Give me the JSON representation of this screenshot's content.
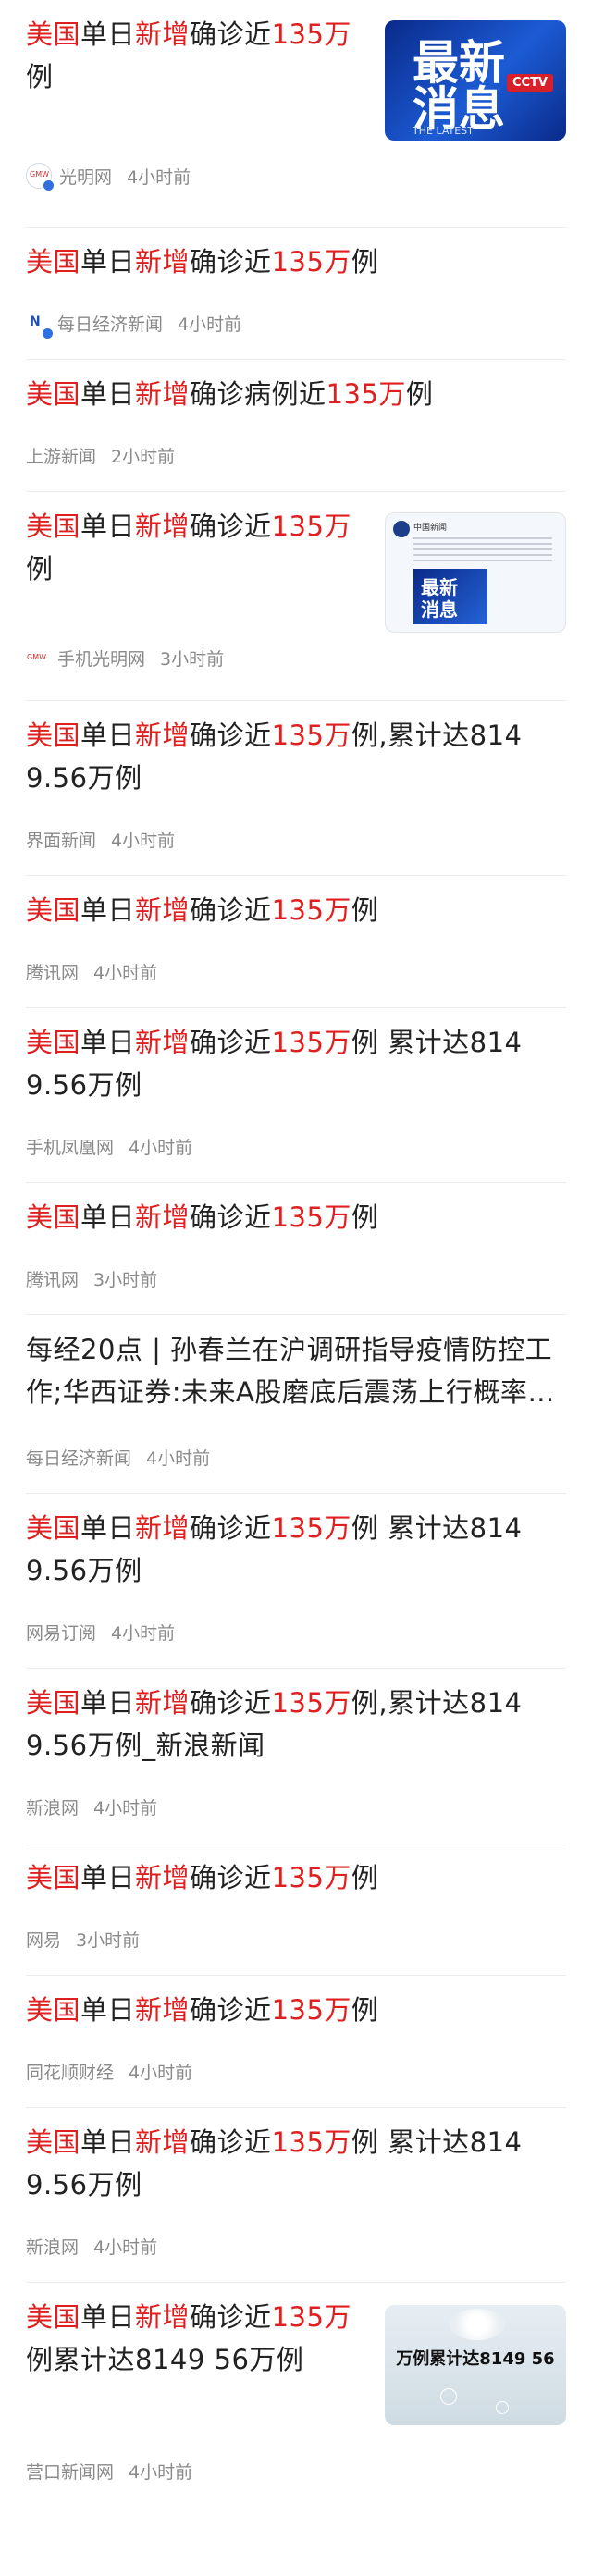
{
  "items": [
    {
      "title": [
        "美国",
        "单日",
        "新增",
        "确诊近",
        "135万",
        "例"
      ],
      "source": "光明网",
      "time": "4小时前",
      "logo": "gmw-logo",
      "thumb": {
        "line1": "最新",
        "line2": "消息",
        "sub": "THE LATEST",
        "badge": "CCTV"
      }
    },
    {
      "title": [
        "美国",
        "单日",
        "新增",
        "确诊近",
        "135万",
        "例"
      ],
      "source": "每日经济新闻",
      "time": "4小时前",
      "logo": "nbd-logo"
    },
    {
      "title": [
        "美国",
        "单日",
        "新增",
        "确诊病例近",
        "135万",
        "例"
      ],
      "source": "上游新闻",
      "time": "2小时前"
    },
    {
      "title": [
        "美国",
        "单日",
        "新增",
        "确诊近",
        "135万",
        "例"
      ],
      "source": "手机光明网",
      "time": "3小时前",
      "logo": "gmw-logo-small",
      "thumb": {
        "line1": "最新",
        "line2": "消息",
        "header": "中国新闻"
      }
    },
    {
      "title": [
        "美国",
        "单日",
        "新增",
        "确诊近",
        "135万",
        "例,累计达8149.56万例"
      ],
      "source": "界面新闻",
      "time": "4小时前"
    },
    {
      "title": [
        "美国",
        "单日",
        "新增",
        "确诊近",
        "135万",
        "例"
      ],
      "source": "腾讯网",
      "time": "4小时前"
    },
    {
      "title": [
        "美国",
        "单日",
        "新增",
        "确诊近",
        "135万",
        "例 累计达8149.56万例"
      ],
      "source": "手机凤凰网",
      "time": "4小时前"
    },
    {
      "title": [
        "美国",
        "单日",
        "新增",
        "确诊近",
        "135万",
        "例"
      ],
      "source": "腾讯网",
      "time": "3小时前"
    },
    {
      "plain": "每经20点 | 孙春兰在沪调研指导疫情防控工作;华西证券:未来A股磨底后震荡上行概率…",
      "source": "每日经济新闻",
      "time": "4小时前"
    },
    {
      "title": [
        "美国",
        "单日",
        "新增",
        "确诊近",
        "135万",
        "例 累计达8149.56万例"
      ],
      "source": "网易订阅",
      "time": "4小时前"
    },
    {
      "title": [
        "美国",
        "单日",
        "新增",
        "确诊近",
        "135万",
        "例,累计达8149.56万例_新浪新闻"
      ],
      "source": "新浪网",
      "time": "4小时前"
    },
    {
      "title": [
        "美国",
        "单日",
        "新增",
        "确诊近",
        "135万",
        "例"
      ],
      "source": "网易",
      "time": "3小时前"
    },
    {
      "title": [
        "美国",
        "单日",
        "新增",
        "确诊近",
        "135万",
        "例"
      ],
      "source": "同花顺财经",
      "time": "4小时前"
    },
    {
      "title": [
        "美国",
        "单日",
        "新增",
        "确诊近",
        "135万",
        "例 累计达8149.56万例"
      ],
      "source": "新浪网",
      "time": "4小时前"
    },
    {
      "title": [
        "美国",
        "单日",
        "新增",
        "确诊近",
        "135万",
        "例累计达8149 56万例"
      ],
      "source": "营口新闻网",
      "time": "4小时前",
      "thumb": {
        "caption": "万例累计达8149 56"
      }
    }
  ],
  "colors": {
    "highlight": "#e02020",
    "text": "#222222",
    "meta": "#8a8a8a"
  }
}
